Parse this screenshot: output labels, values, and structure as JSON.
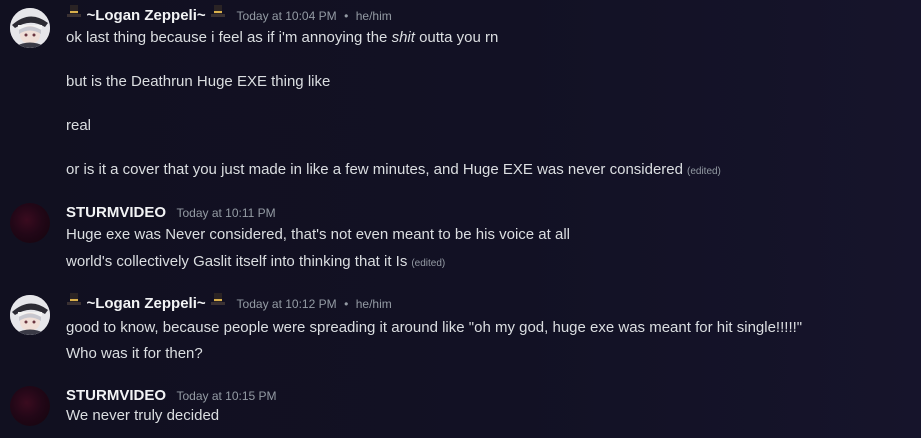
{
  "messages": [
    {
      "author": "~Logan Zeppeli~",
      "time": "Today at 10:04 PM",
      "separator": "•",
      "pronouns": "he/him",
      "lines": {
        "l1a": "ok last thing because i feel as if i'm annoying the ",
        "l1b": "shit",
        "l1c": " outta you rn",
        "l2": "but is the Deathrun Huge EXE thing like",
        "l3": "real",
        "l4": "or is it a cover that you just made in like a few minutes, and Huge EXE was never considered"
      },
      "edited": "(edited)"
    },
    {
      "author": "STURMVIDEO",
      "time": "Today at 10:11 PM",
      "lines": {
        "l1": "Huge exe was Never considered, that's not even meant to be his voice at all",
        "l2": "world's collectively Gaslit itself into thinking that it Is"
      },
      "edited": "(edited)"
    },
    {
      "author": "~Logan Zeppeli~",
      "time": "Today at 10:12 PM",
      "separator": "•",
      "pronouns": "he/him",
      "lines": {
        "l1": "good to know, because people were spreading it around like \"oh my god, huge exe was meant for hit single!!!!!\"",
        "l2": "Who was it for then?"
      }
    },
    {
      "author": "STURMVIDEO",
      "time": "Today at 10:15 PM",
      "lines": {
        "l1": "We never truly decided"
      }
    }
  ],
  "icons": {
    "name_decoration": "top-hat-icon",
    "hat_color": "#d9b04c"
  }
}
